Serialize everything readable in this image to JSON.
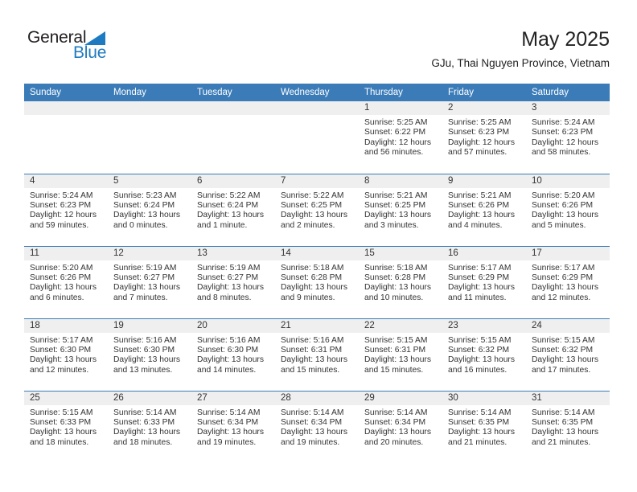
{
  "brand": {
    "name_top": "General",
    "name_bottom": "Blue",
    "color_dark": "#231f20",
    "color_blue": "#1f7bc1"
  },
  "header": {
    "title": "May 2025",
    "subtitle": "GJu, Thai Nguyen Province, Vietnam"
  },
  "theme": {
    "header_row_bg": "#3b7cb8",
    "daynum_band_bg": "#efefef",
    "row_divider": "#3b7cb8",
    "text": "#333333"
  },
  "weekday_headers": [
    "Sunday",
    "Monday",
    "Tuesday",
    "Wednesday",
    "Thursday",
    "Friday",
    "Saturday"
  ],
  "weeks": [
    [
      {
        "day": "",
        "empty": true,
        "sunrise": "",
        "sunset": "",
        "daylight_1": "",
        "daylight_2": ""
      },
      {
        "day": "",
        "empty": true,
        "sunrise": "",
        "sunset": "",
        "daylight_1": "",
        "daylight_2": ""
      },
      {
        "day": "",
        "empty": true,
        "sunrise": "",
        "sunset": "",
        "daylight_1": "",
        "daylight_2": ""
      },
      {
        "day": "",
        "empty": true,
        "sunrise": "",
        "sunset": "",
        "daylight_1": "",
        "daylight_2": ""
      },
      {
        "day": "1",
        "empty": false,
        "sunrise": "Sunrise: 5:25 AM",
        "sunset": "Sunset: 6:22 PM",
        "daylight_1": "Daylight: 12 hours",
        "daylight_2": "and 56 minutes."
      },
      {
        "day": "2",
        "empty": false,
        "sunrise": "Sunrise: 5:25 AM",
        "sunset": "Sunset: 6:23 PM",
        "daylight_1": "Daylight: 12 hours",
        "daylight_2": "and 57 minutes."
      },
      {
        "day": "3",
        "empty": false,
        "sunrise": "Sunrise: 5:24 AM",
        "sunset": "Sunset: 6:23 PM",
        "daylight_1": "Daylight: 12 hours",
        "daylight_2": "and 58 minutes."
      }
    ],
    [
      {
        "day": "4",
        "empty": false,
        "sunrise": "Sunrise: 5:24 AM",
        "sunset": "Sunset: 6:23 PM",
        "daylight_1": "Daylight: 12 hours",
        "daylight_2": "and 59 minutes."
      },
      {
        "day": "5",
        "empty": false,
        "sunrise": "Sunrise: 5:23 AM",
        "sunset": "Sunset: 6:24 PM",
        "daylight_1": "Daylight: 13 hours",
        "daylight_2": "and 0 minutes."
      },
      {
        "day": "6",
        "empty": false,
        "sunrise": "Sunrise: 5:22 AM",
        "sunset": "Sunset: 6:24 PM",
        "daylight_1": "Daylight: 13 hours",
        "daylight_2": "and 1 minute."
      },
      {
        "day": "7",
        "empty": false,
        "sunrise": "Sunrise: 5:22 AM",
        "sunset": "Sunset: 6:25 PM",
        "daylight_1": "Daylight: 13 hours",
        "daylight_2": "and 2 minutes."
      },
      {
        "day": "8",
        "empty": false,
        "sunrise": "Sunrise: 5:21 AM",
        "sunset": "Sunset: 6:25 PM",
        "daylight_1": "Daylight: 13 hours",
        "daylight_2": "and 3 minutes."
      },
      {
        "day": "9",
        "empty": false,
        "sunrise": "Sunrise: 5:21 AM",
        "sunset": "Sunset: 6:26 PM",
        "daylight_1": "Daylight: 13 hours",
        "daylight_2": "and 4 minutes."
      },
      {
        "day": "10",
        "empty": false,
        "sunrise": "Sunrise: 5:20 AM",
        "sunset": "Sunset: 6:26 PM",
        "daylight_1": "Daylight: 13 hours",
        "daylight_2": "and 5 minutes."
      }
    ],
    [
      {
        "day": "11",
        "empty": false,
        "sunrise": "Sunrise: 5:20 AM",
        "sunset": "Sunset: 6:26 PM",
        "daylight_1": "Daylight: 13 hours",
        "daylight_2": "and 6 minutes."
      },
      {
        "day": "12",
        "empty": false,
        "sunrise": "Sunrise: 5:19 AM",
        "sunset": "Sunset: 6:27 PM",
        "daylight_1": "Daylight: 13 hours",
        "daylight_2": "and 7 minutes."
      },
      {
        "day": "13",
        "empty": false,
        "sunrise": "Sunrise: 5:19 AM",
        "sunset": "Sunset: 6:27 PM",
        "daylight_1": "Daylight: 13 hours",
        "daylight_2": "and 8 minutes."
      },
      {
        "day": "14",
        "empty": false,
        "sunrise": "Sunrise: 5:18 AM",
        "sunset": "Sunset: 6:28 PM",
        "daylight_1": "Daylight: 13 hours",
        "daylight_2": "and 9 minutes."
      },
      {
        "day": "15",
        "empty": false,
        "sunrise": "Sunrise: 5:18 AM",
        "sunset": "Sunset: 6:28 PM",
        "daylight_1": "Daylight: 13 hours",
        "daylight_2": "and 10 minutes."
      },
      {
        "day": "16",
        "empty": false,
        "sunrise": "Sunrise: 5:17 AM",
        "sunset": "Sunset: 6:29 PM",
        "daylight_1": "Daylight: 13 hours",
        "daylight_2": "and 11 minutes."
      },
      {
        "day": "17",
        "empty": false,
        "sunrise": "Sunrise: 5:17 AM",
        "sunset": "Sunset: 6:29 PM",
        "daylight_1": "Daylight: 13 hours",
        "daylight_2": "and 12 minutes."
      }
    ],
    [
      {
        "day": "18",
        "empty": false,
        "sunrise": "Sunrise: 5:17 AM",
        "sunset": "Sunset: 6:30 PM",
        "daylight_1": "Daylight: 13 hours",
        "daylight_2": "and 12 minutes."
      },
      {
        "day": "19",
        "empty": false,
        "sunrise": "Sunrise: 5:16 AM",
        "sunset": "Sunset: 6:30 PM",
        "daylight_1": "Daylight: 13 hours",
        "daylight_2": "and 13 minutes."
      },
      {
        "day": "20",
        "empty": false,
        "sunrise": "Sunrise: 5:16 AM",
        "sunset": "Sunset: 6:30 PM",
        "daylight_1": "Daylight: 13 hours",
        "daylight_2": "and 14 minutes."
      },
      {
        "day": "21",
        "empty": false,
        "sunrise": "Sunrise: 5:16 AM",
        "sunset": "Sunset: 6:31 PM",
        "daylight_1": "Daylight: 13 hours",
        "daylight_2": "and 15 minutes."
      },
      {
        "day": "22",
        "empty": false,
        "sunrise": "Sunrise: 5:15 AM",
        "sunset": "Sunset: 6:31 PM",
        "daylight_1": "Daylight: 13 hours",
        "daylight_2": "and 15 minutes."
      },
      {
        "day": "23",
        "empty": false,
        "sunrise": "Sunrise: 5:15 AM",
        "sunset": "Sunset: 6:32 PM",
        "daylight_1": "Daylight: 13 hours",
        "daylight_2": "and 16 minutes."
      },
      {
        "day": "24",
        "empty": false,
        "sunrise": "Sunrise: 5:15 AM",
        "sunset": "Sunset: 6:32 PM",
        "daylight_1": "Daylight: 13 hours",
        "daylight_2": "and 17 minutes."
      }
    ],
    [
      {
        "day": "25",
        "empty": false,
        "sunrise": "Sunrise: 5:15 AM",
        "sunset": "Sunset: 6:33 PM",
        "daylight_1": "Daylight: 13 hours",
        "daylight_2": "and 18 minutes."
      },
      {
        "day": "26",
        "empty": false,
        "sunrise": "Sunrise: 5:14 AM",
        "sunset": "Sunset: 6:33 PM",
        "daylight_1": "Daylight: 13 hours",
        "daylight_2": "and 18 minutes."
      },
      {
        "day": "27",
        "empty": false,
        "sunrise": "Sunrise: 5:14 AM",
        "sunset": "Sunset: 6:34 PM",
        "daylight_1": "Daylight: 13 hours",
        "daylight_2": "and 19 minutes."
      },
      {
        "day": "28",
        "empty": false,
        "sunrise": "Sunrise: 5:14 AM",
        "sunset": "Sunset: 6:34 PM",
        "daylight_1": "Daylight: 13 hours",
        "daylight_2": "and 19 minutes."
      },
      {
        "day": "29",
        "empty": false,
        "sunrise": "Sunrise: 5:14 AM",
        "sunset": "Sunset: 6:34 PM",
        "daylight_1": "Daylight: 13 hours",
        "daylight_2": "and 20 minutes."
      },
      {
        "day": "30",
        "empty": false,
        "sunrise": "Sunrise: 5:14 AM",
        "sunset": "Sunset: 6:35 PM",
        "daylight_1": "Daylight: 13 hours",
        "daylight_2": "and 21 minutes."
      },
      {
        "day": "31",
        "empty": false,
        "sunrise": "Sunrise: 5:14 AM",
        "sunset": "Sunset: 6:35 PM",
        "daylight_1": "Daylight: 13 hours",
        "daylight_2": "and 21 minutes."
      }
    ]
  ]
}
